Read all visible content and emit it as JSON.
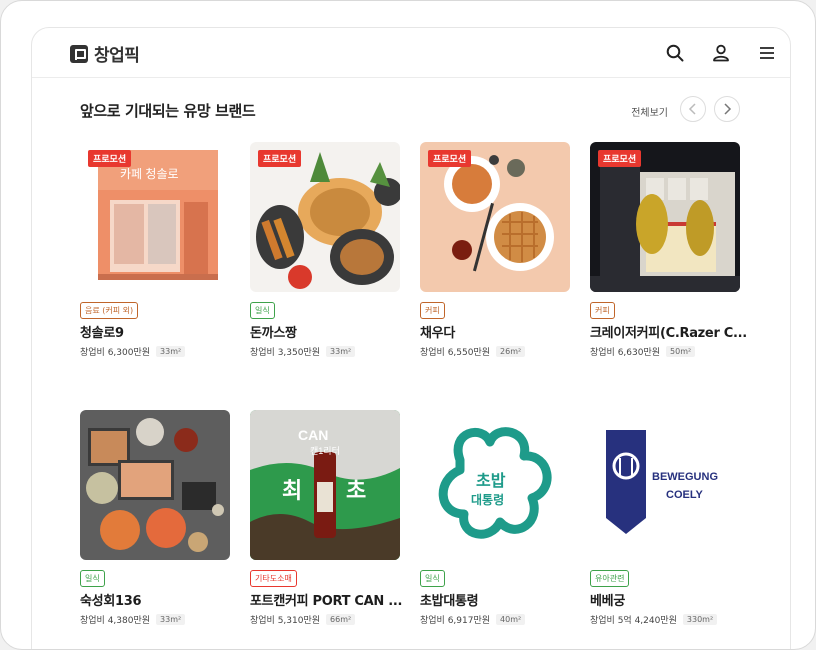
{
  "app": {
    "logo_text": "창업픽"
  },
  "header": {
    "icons": [
      "search-icon",
      "user-icon",
      "menu-icon"
    ]
  },
  "section": {
    "title": "앞으로 기대되는 유망 브랜드",
    "view_all": "전체보기"
  },
  "colors": {
    "promo": "#e8382f"
  },
  "cards": [
    {
      "name": "청솔로9",
      "category": "음료 (커피 외)",
      "cat_color": "#c0652a",
      "promo": "프로모션",
      "cost": "창업비 6,300만원",
      "area": "33m²"
    },
    {
      "name": "돈까스짱",
      "category": "일식",
      "cat_color": "#3ea24a",
      "promo": "프로모션",
      "cost": "창업비 3,350만원",
      "area": "33m²"
    },
    {
      "name": "채우다",
      "category": "커피",
      "cat_color": "#c0652a",
      "promo": "프로모션",
      "cost": "창업비 6,550만원",
      "area": "26m²"
    },
    {
      "name": "크레이저커피(C.Razer C...",
      "category": "커피",
      "cat_color": "#c0652a",
      "promo": "프로모션",
      "cost": "창업비 6,630만원",
      "area": "50m²"
    },
    {
      "name": "숙성회136",
      "category": "일식",
      "cat_color": "#3ea24a",
      "promo": "",
      "cost": "창업비 4,380만원",
      "area": "33m²"
    },
    {
      "name": "포트캔커피 PORT CAN ...",
      "category": "기타도소매",
      "cat_color": "#e8382f",
      "promo": "",
      "cost": "창업비 5,310만원",
      "area": "66m²"
    },
    {
      "name": "초밥대통령",
      "category": "일식",
      "cat_color": "#3ea24a",
      "promo": "",
      "cost": "창업비 6,917만원",
      "area": "40m²"
    },
    {
      "name": "베베궁",
      "category": "유아관련",
      "cat_color": "#3ea24a",
      "promo": "",
      "cost": "창업비 5억 4,240만원",
      "area": "330m²"
    }
  ],
  "thumb_text": {
    "cafe_sign": "카페 청솔로",
    "can_label": "CAN",
    "can_sub": "캔1리터",
    "choi": "최",
    "cho": "초",
    "chobap_1": "초밥",
    "chobap_2": "대통령",
    "bewegung_1": "BEWEGUNG",
    "bewegung_2": "COELY"
  }
}
